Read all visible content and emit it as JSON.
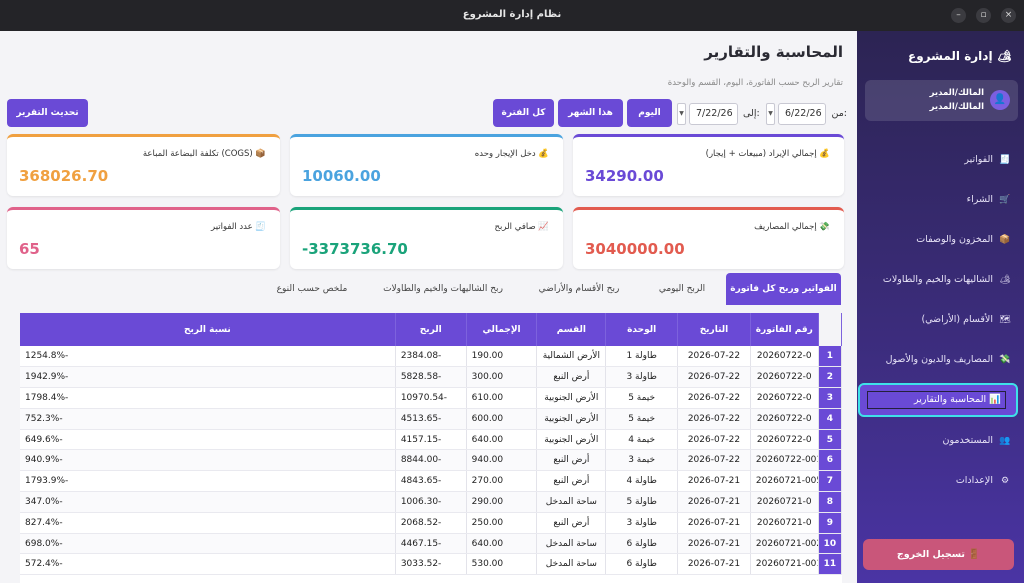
{
  "window": {
    "title": "نظام إدارة المشروع"
  },
  "page": {
    "title": "المحاسبة والتقارير",
    "subtitle": "تقارير الربح حسب الفاتورة، اليوم، القسم والوحدة"
  },
  "filters": {
    "from_label": "من:",
    "from_date": "6/22/26",
    "to_label": "إلى:",
    "to_date": "7/22/26",
    "today_label": "اليوم",
    "month_label": "هذا الشهر",
    "all_label": "كل الفترة",
    "refresh_label": "تحديث التقرير"
  },
  "cards": [
    {
      "label": "إجمالي الإيراد (مبيعات + إيجار)",
      "icon": "💰",
      "value": "34290.00",
      "color": "#6a4ad6"
    },
    {
      "label": "دخل الإيجار وحده",
      "icon": "💰",
      "value": "10060.00",
      "color": "#4aa3df"
    },
    {
      "label": "تكلفة البضاعة المباعة (COGS)",
      "icon": "📦",
      "value": "368026.70",
      "color": "#f0a040"
    },
    {
      "label": "إجمالي المصاريف",
      "icon": "💸",
      "value": "3040000.00",
      "color": "#e25b4f"
    },
    {
      "label": "صافي الربح",
      "icon": "📈",
      "value": "-3373736.70",
      "color": "#1aa37a"
    },
    {
      "label": "عدد الفواتير",
      "icon": "🧾",
      "value": "65",
      "color": "#e0628a"
    }
  ],
  "tabs": [
    "الفواتير وربح كل فاتورة",
    "الربح اليومي",
    "ربح الأقسام والأراضي",
    "ربح الشاليهات والخيم والطاولات",
    "ملخص حسب النوع"
  ],
  "table": {
    "headers": [
      "رقم الفاتورة",
      "التاريخ",
      "الوحدة",
      "القسم",
      "الإجمالي",
      "الربح",
      "نسبة الربح"
    ],
    "rows": [
      [
        "1",
        "20260722-0",
        "2026-07-22",
        "طاولة 1",
        "الأرض الشمالية",
        "190.00",
        "2384.08-",
        "1254.8%-"
      ],
      [
        "2",
        "20260722-0",
        "2026-07-22",
        "طاولة 3",
        "أرض النبع",
        "300.00",
        "5828.58-",
        "1942.9%-"
      ],
      [
        "3",
        "20260722-0",
        "2026-07-22",
        "خيمة 5",
        "الأرض الجنوبية",
        "610.00",
        "10970.54-",
        "1798.4%-"
      ],
      [
        "4",
        "20260722-0",
        "2026-07-22",
        "خيمة 5",
        "الأرض الجنوبية",
        "600.00",
        "4513.65-",
        "752.3%-"
      ],
      [
        "5",
        "20260722-0",
        "2026-07-22",
        "خيمة 4",
        "الأرض الجنوبية",
        "640.00",
        "4157.15-",
        "649.6%-"
      ],
      [
        "6",
        "20260722-001",
        "2026-07-22",
        "خيمة 3",
        "أرض النبع",
        "940.00",
        "8844.00-",
        "940.9%-"
      ],
      [
        "7",
        "20260721-005",
        "2026-07-21",
        "طاولة 4",
        "أرض النبع",
        "270.00",
        "4843.65-",
        "1793.9%-"
      ],
      [
        "8",
        "20260721-0",
        "2026-07-21",
        "طاولة 5",
        "ساحة المدخل",
        "290.00",
        "1006.30-",
        "347.0%-"
      ],
      [
        "9",
        "20260721-0",
        "2026-07-21",
        "طاولة 3",
        "أرض النبع",
        "250.00",
        "2068.52-",
        "827.4%-"
      ],
      [
        "10",
        "20260721-002",
        "2026-07-21",
        "طاولة 6",
        "ساحة المدخل",
        "640.00",
        "4467.15-",
        "698.0%-"
      ],
      [
        "11",
        "20260721-001",
        "2026-07-21",
        "طاولة 6",
        "ساحة المدخل",
        "530.00",
        "3033.52-",
        "572.4%-"
      ]
    ]
  },
  "sidebar": {
    "title": "إدارة المشروع",
    "user_line1": "المالك/المدير",
    "user_line2": "المالك/المدير",
    "items": [
      {
        "label": "الفواتير",
        "icon": "🧾"
      },
      {
        "label": "الشراء",
        "icon": "🛒"
      },
      {
        "label": "المخزون والوصفات",
        "icon": "📦"
      },
      {
        "label": "الشاليهات والخيم والطاولات",
        "icon": "🏕"
      },
      {
        "label": "الأقسام (الأراضي)",
        "icon": "🗺"
      },
      {
        "label": "المصاريف والديون والأصول",
        "icon": "💸"
      },
      {
        "label": "المحاسبة والتقارير",
        "icon": "📊"
      },
      {
        "label": "المستخدمون",
        "icon": "👥"
      },
      {
        "label": "الإعدادات",
        "icon": "⚙"
      }
    ],
    "logout_label": "تسجيل الخروج"
  },
  "colors": {
    "accent": "#6a4ad6",
    "active_border": "#3ee1e9",
    "logout": "#c9567a"
  }
}
